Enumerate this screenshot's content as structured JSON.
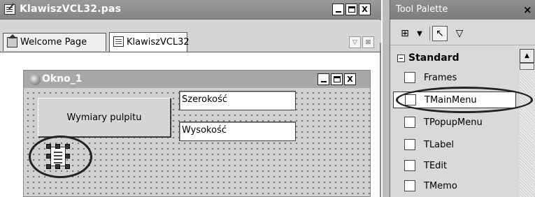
{
  "editor": {
    "title": "KlawiszVCL32.pas",
    "tabs": [
      {
        "label": "Welcome Page",
        "icon": "home-icon"
      },
      {
        "label": "KlawiszVCL32",
        "icon": "unit-file-icon"
      }
    ],
    "window_buttons": {
      "minimize": "_",
      "maximize": "□",
      "close": "X"
    }
  },
  "form": {
    "title": "Okno_1",
    "button_label": "Wymiary pulpitu",
    "fields": [
      {
        "value": "Szerokość"
      },
      {
        "value": "Wysokość"
      }
    ],
    "component": "main-menu-component"
  },
  "palette": {
    "title": "Tool Palette",
    "close": "×",
    "category": "Standard",
    "items": [
      {
        "label": "Frames",
        "icon": "frames-icon"
      },
      {
        "label": "TMainMenu",
        "icon": "mainmenu-icon",
        "selected": true
      },
      {
        "label": "TPopupMenu",
        "icon": "popupmenu-icon"
      },
      {
        "label": "TLabel",
        "icon": "label-icon"
      },
      {
        "label": "TEdit",
        "icon": "edit-icon"
      },
      {
        "label": "TMemo",
        "icon": "memo-icon"
      }
    ]
  }
}
